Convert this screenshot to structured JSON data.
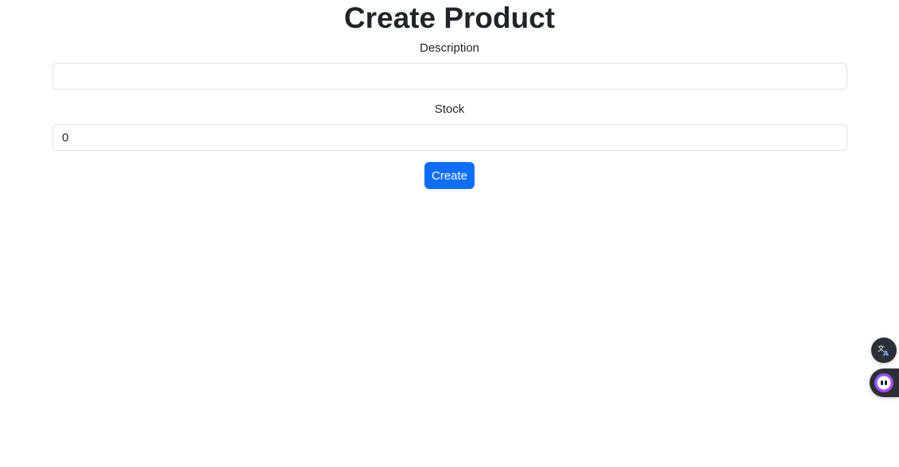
{
  "page": {
    "title": "Create Product"
  },
  "form": {
    "description": {
      "label": "Description",
      "value": "",
      "placeholder": ""
    },
    "stock": {
      "label": "Stock",
      "value": "0"
    },
    "submit_label": "Create"
  },
  "floating_widgets": {
    "translate_icon": "translate-icon",
    "assistant_icon": "assistant-bot-icon"
  },
  "colors": {
    "primary": "#0d6efd",
    "text": "#212529",
    "border": "#dee2e6",
    "widget_bg": "#2b2f36"
  }
}
